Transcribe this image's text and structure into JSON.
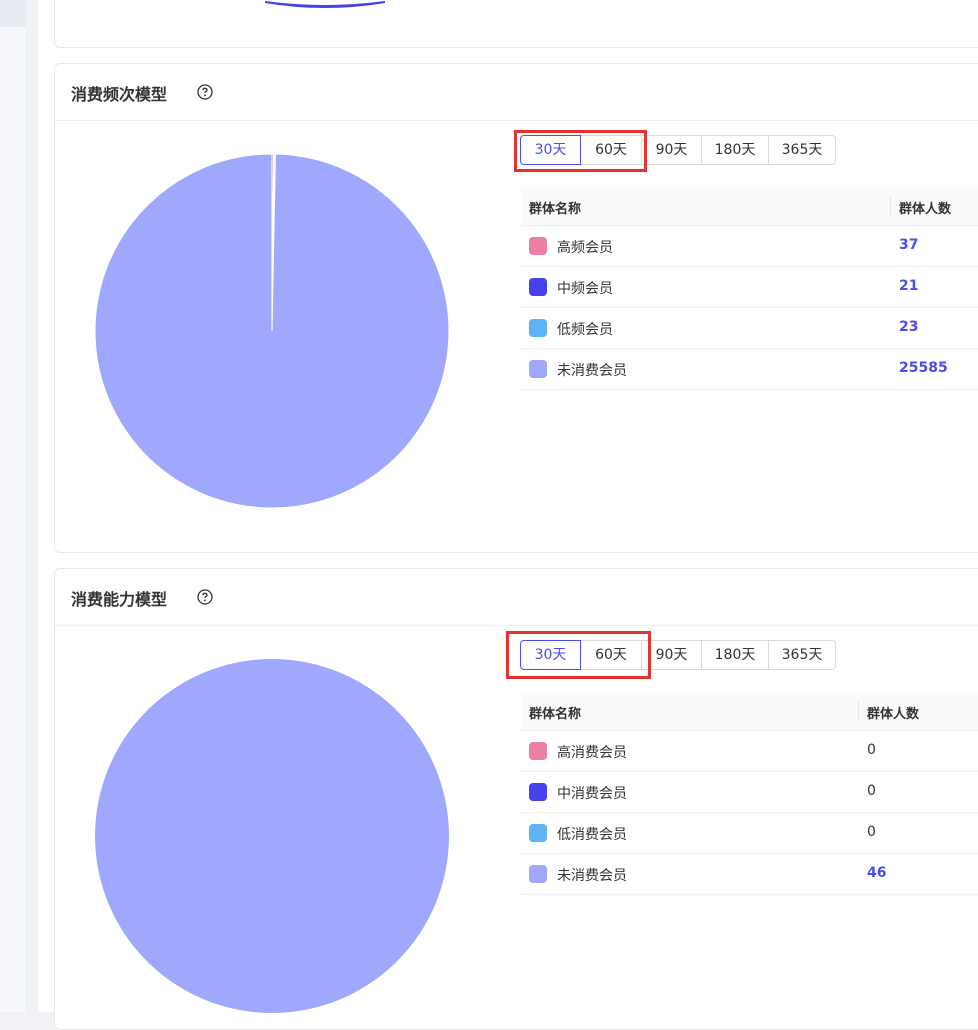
{
  "colors": {
    "accent": "#4a4ef0",
    "highlight": "#e8322e",
    "pie_fill": "#a0a8fd"
  },
  "segment_options": [
    "30天",
    "60天",
    "90天",
    "180天",
    "365天"
  ],
  "frequency_model": {
    "title": "消费频次模型",
    "help_icon": "question-circle-icon",
    "selected_range": "30天",
    "table": {
      "headers": [
        "群体名称",
        "群体人数"
      ],
      "rows": [
        {
          "name": "高频会员",
          "count": "37",
          "color": "#ec7fa6"
        },
        {
          "name": "中频会员",
          "count": "21",
          "color": "#4640ee"
        },
        {
          "name": "低频会员",
          "count": "23",
          "color": "#5eb4f7"
        },
        {
          "name": "未消费会员",
          "count": "25585",
          "color": "#a0a8fd"
        }
      ]
    }
  },
  "capacity_model": {
    "title": "消费能力模型",
    "help_icon": "question-circle-icon",
    "selected_range": "30天",
    "table": {
      "headers": [
        "群体名称",
        "群体人数"
      ],
      "rows": [
        {
          "name": "高消费会员",
          "count": "0",
          "color": "#ec7fa6"
        },
        {
          "name": "中消费会员",
          "count": "0",
          "color": "#4640ee"
        },
        {
          "name": "低消费会员",
          "count": "0",
          "color": "#5eb4f7"
        },
        {
          "name": "未消费会员",
          "count": "46",
          "color": "#a0a8fd"
        }
      ]
    }
  },
  "chart_data": [
    {
      "type": "pie",
      "categories": [
        "高频会员",
        "中频会员",
        "低频会员",
        "未消费会员"
      ],
      "values": [
        37,
        21,
        23,
        25585
      ],
      "colors": [
        "#ec7fa6",
        "#4640ee",
        "#5eb4f7",
        "#a0a8fd"
      ]
    },
    {
      "type": "pie",
      "categories": [
        "高消费会员",
        "中消费会员",
        "低消费会员",
        "未消费会员"
      ],
      "values": [
        0,
        0,
        0,
        46
      ],
      "colors": [
        "#ec7fa6",
        "#4640ee",
        "#5eb4f7",
        "#a0a8fd"
      ]
    }
  ]
}
